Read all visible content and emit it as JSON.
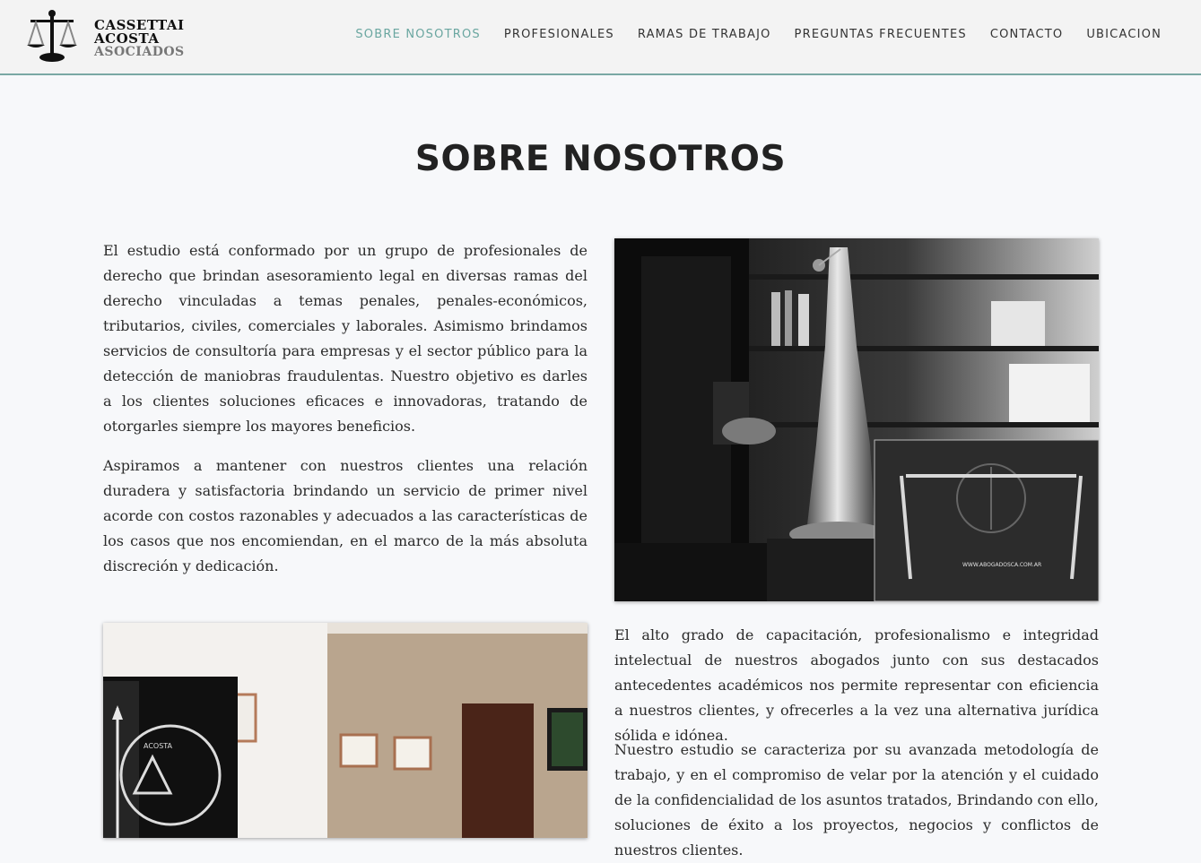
{
  "brand": {
    "line1": "CASSETTAI",
    "line2": "ACOSTA",
    "line3": "ASOCIADOS"
  },
  "nav": {
    "items": [
      {
        "label": "SOBRE NOSOTROS",
        "active": true
      },
      {
        "label": "PROFESIONALES",
        "active": false
      },
      {
        "label": "RAMAS DE TRABAJO",
        "active": false
      },
      {
        "label": "PREGUNTAS FRECUENTES",
        "active": false
      },
      {
        "label": "CONTACTO",
        "active": false
      },
      {
        "label": "UBICACION",
        "active": false
      }
    ]
  },
  "main": {
    "title": "SOBRE NOSOTROS",
    "paragraphs": [
      "El estudio está conformado por un grupo de profesionales de derecho que brindan asesoramiento legal en diversas ramas del derecho vinculadas a temas penales, penales-económicos, tributarios, civiles, comerciales y laborales. Asimismo brindamos servicios de consultoría para empresas y el sector público para la detección de maniobras fraudulentas. Nuestro objetivo es darles a los clientes soluciones eficaces e innovadoras, tratando de otorgarles siempre los mayores beneficios.",
      "Aspiramos a mantener con nuestros clientes una relación duradera y satisfactoria brindando un servicio de primer nivel acorde con costos razonables y adecuados a las características de los casos que nos encomiendan, en el marco de la más absoluta discreción y dedicación.",
      "El alto grado de capacitación, profesionalismo e integridad intelectual de nuestros abogados junto con sus destacados antecedentes académicos nos permite representar con eficiencia a nuestros clientes, y ofrecerles a la vez una alternativa jurídica sólida e idónea.",
      "Nuestro estudio se caracteriza por su avanzada metodología de trabajo, y en el compromiso de velar por la atención y el cuidado de la confidencialidad de los asuntos tratados, Brindando con ello, soluciones de éxito a los proyectos, negocios y conflictos de nuestros clientes."
    ],
    "card_url": "WWW.ABOGADOSCA.COM.AR",
    "office_sign": "ACOSTA"
  },
  "colors": {
    "accent": "#6aa6a0",
    "header_bg": "#f3f3f3",
    "page_bg": "#f7f8fa"
  }
}
